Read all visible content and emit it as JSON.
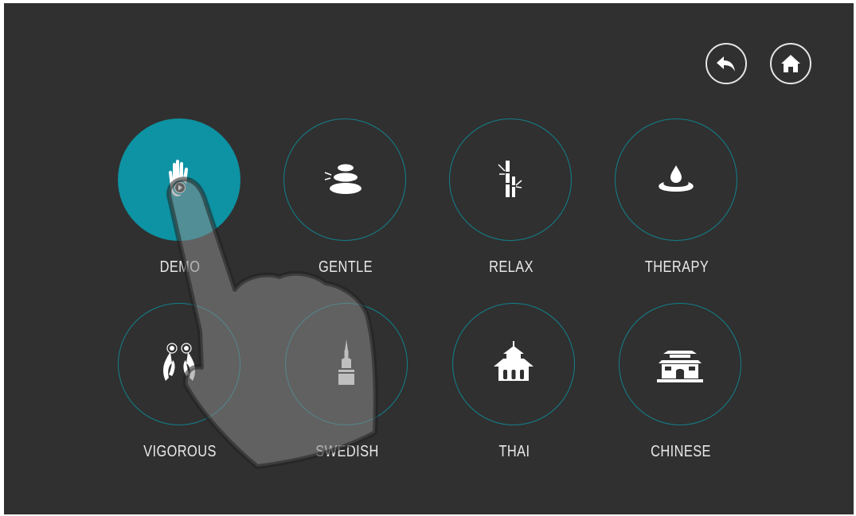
{
  "nav": {
    "back_icon": "back-arrow-icon",
    "home_icon": "home-icon"
  },
  "accent_color": "#0d93a3",
  "ring_color": "#12808c",
  "background_color": "#303030",
  "modes": [
    {
      "label": "DEMO",
      "icon": "raised-hand-play-icon",
      "active": true
    },
    {
      "label": "GENTLE",
      "icon": "stacked-stones-icon",
      "active": false
    },
    {
      "label": "RELAX",
      "icon": "bamboo-icon",
      "active": false
    },
    {
      "label": "THERAPY",
      "icon": "water-drop-icon",
      "active": false
    },
    {
      "label": "VIGOROUS",
      "icon": "hands-tapping-icon",
      "active": false
    },
    {
      "label": "SWEDISH",
      "icon": "swedish-spire-icon",
      "active": false
    },
    {
      "label": "THAI",
      "icon": "thai-temple-icon",
      "active": false
    },
    {
      "label": "CHINESE",
      "icon": "chinese-gate-icon",
      "active": false
    }
  ]
}
